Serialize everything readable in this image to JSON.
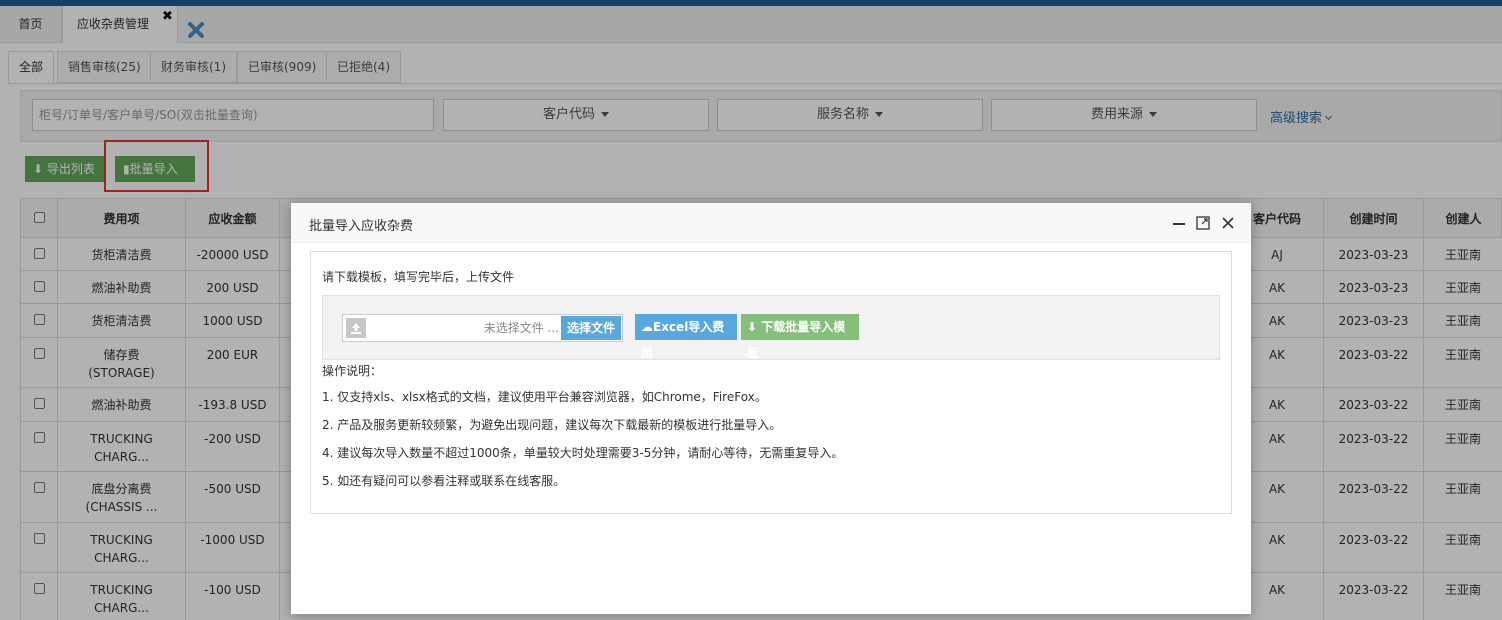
{
  "tabs": {
    "home": "首页",
    "active": "应收杂费管理",
    "close_symbol": "✖"
  },
  "subtabs": [
    "全部",
    "销售审核(25)",
    "财务审核(1)",
    "已审核(909)",
    "已拒绝(4)"
  ],
  "search": {
    "placeholder": "柜号/订单号/客户单号/SO(双击批量查询)",
    "customer_code": "客户代码",
    "service_name": "服务名称",
    "fee_source": "费用来源",
    "advanced": "高级搜索"
  },
  "toolbar": {
    "export": "导出列表",
    "import": "批量导入"
  },
  "table": {
    "headers": {
      "fee": "费用项",
      "amount": "应收金额",
      "customer": "客户代码",
      "created": "创建时间",
      "creator": "创建人"
    },
    "rows": [
      {
        "fee": "货柜清洁费",
        "fee2": "",
        "amount": "-20000 USD",
        "customer": "AJ",
        "created": "2023-03-23",
        "creator": "王亚南"
      },
      {
        "fee": "燃油补助费",
        "fee2": "",
        "amount": "200 USD",
        "customer": "AK",
        "created": "2023-03-23",
        "creator": "王亚南"
      },
      {
        "fee": "货柜清洁费",
        "fee2": "",
        "amount": "1000 USD",
        "customer": "AK",
        "created": "2023-03-23",
        "creator": "王亚南"
      },
      {
        "fee": "储存费",
        "fee2": "(STORAGE)",
        "amount": "200 EUR",
        "customer": "AK",
        "created": "2023-03-22",
        "creator": "王亚南"
      },
      {
        "fee": "燃油补助费",
        "fee2": "",
        "amount": "-193.8 USD",
        "customer": "AK",
        "created": "2023-03-22",
        "creator": "王亚南"
      },
      {
        "fee": "TRUCKING",
        "fee2": "CHARG...",
        "amount": "-200 USD",
        "customer": "AK",
        "created": "2023-03-22",
        "creator": "王亚南"
      },
      {
        "fee": "底盘分离费",
        "fee2": "(CHASSIS ...",
        "amount": "-500 USD",
        "customer": "AK",
        "created": "2023-03-22",
        "creator": "王亚南"
      },
      {
        "fee": "TRUCKING",
        "fee2": "CHARG...",
        "amount": "-1000 USD",
        "customer": "AK",
        "created": "2023-03-22",
        "creator": "王亚南"
      },
      {
        "fee": "TRUCKING",
        "fee2": "CHARG...",
        "amount": "-100 USD",
        "customer": "AK",
        "created": "2023-03-22",
        "creator": "王亚南"
      }
    ]
  },
  "modal": {
    "title": "批量导入应收杂费",
    "tip": "请下载模板，填写完毕后，上传文件",
    "file_placeholder": "未选择文件 ...",
    "choose_file": "选择文件",
    "excel_import": "Excel导入费用",
    "download_template": "下载批量导入模板",
    "ops_title": "操作说明：",
    "ops": [
      "1. 仅支持xls、xlsx格式的文档，建议使用平台兼容浏览器，如Chrome，FireFox。",
      "2. 产品及服务更新较频繁，为避免出现问题，建议每次下载最新的模板进行批量导入。",
      "4. 建议每次导入数量不超过1000条，单量较大时处理需要3-5分钟，请耐心等待，无需重复导入。",
      "5. 如还有疑问可以参看注释或联系在线客服。"
    ]
  },
  "colors": {
    "brand_blue": "#1f5b8e",
    "green_button": "#62a85b",
    "blue_button": "#5aa7dc",
    "highlight_red": "#e8322d"
  }
}
